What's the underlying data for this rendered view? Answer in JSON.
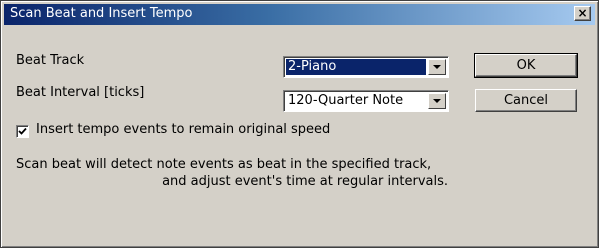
{
  "window": {
    "title": "Scan Beat and Insert Tempo",
    "close_glyph": "×"
  },
  "form": {
    "beat_track_label": "Beat Track",
    "beat_track_value": "2-Piano",
    "beat_interval_label": "Beat Interval [ticks]",
    "beat_interval_value": "120-Quarter Note",
    "insert_tempo_label": "Insert tempo events to remain original speed",
    "insert_tempo_checked": true
  },
  "buttons": {
    "ok_label": "OK",
    "cancel_label": "Cancel"
  },
  "description": {
    "line1": "Scan beat will detect note events as beat in the specified track,",
    "line2": "and adjust event's time at regular intervals."
  }
}
